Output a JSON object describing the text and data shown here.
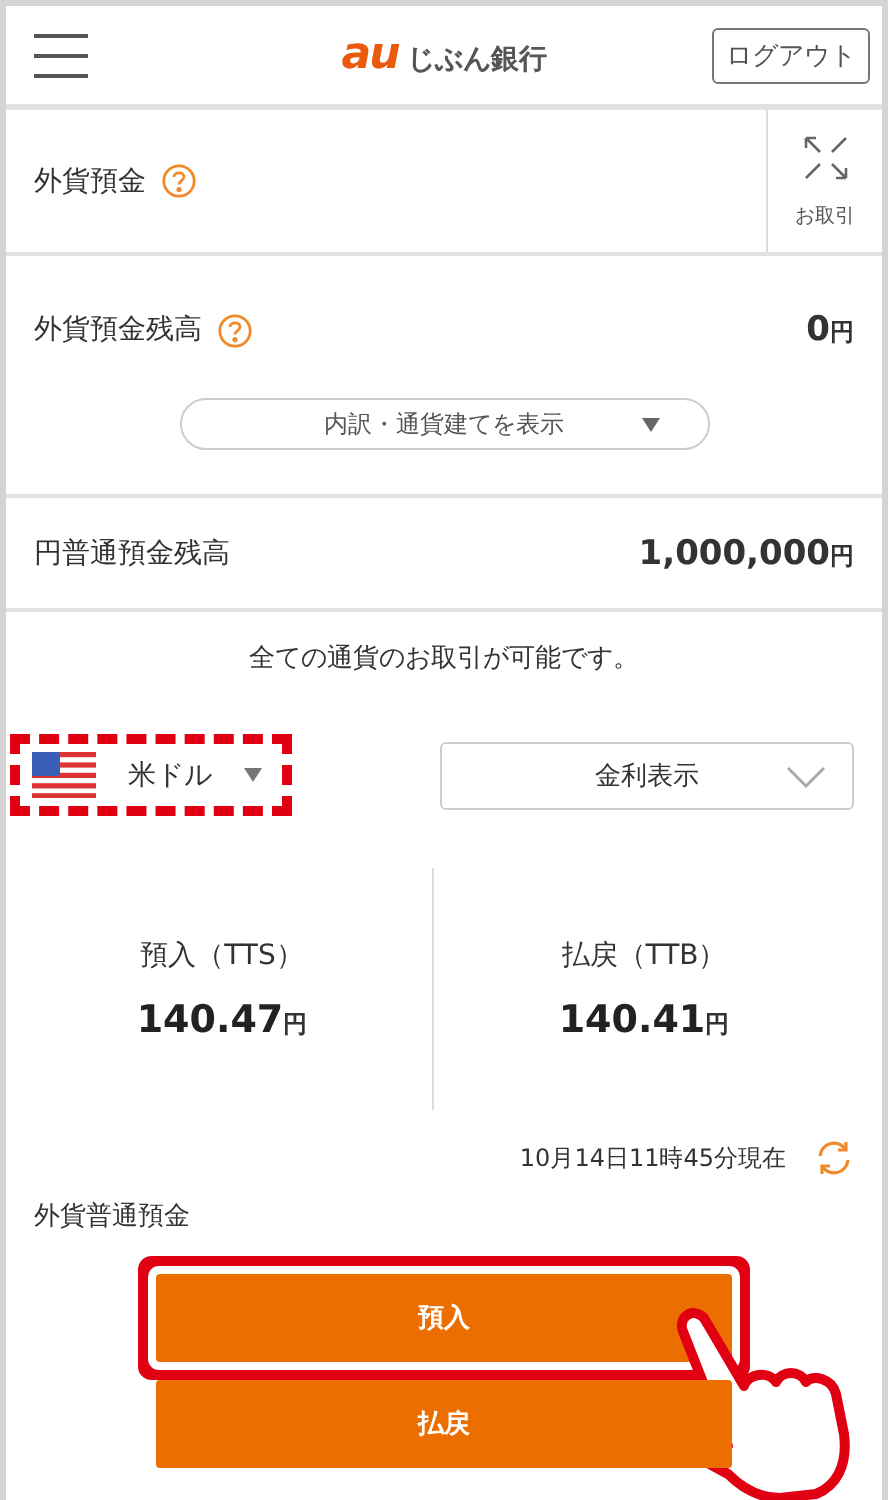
{
  "header": {
    "logo_mark": "au",
    "logo_text": "じぶん銀行",
    "logout": "ログアウト"
  },
  "fx_deposit": {
    "title": "外貨預金",
    "transactions": "お取引"
  },
  "fx_balance": {
    "label": "外貨預金残高",
    "amount": "0",
    "unit": "円",
    "breakdown": "内訳・通貨建てを表示"
  },
  "yen_balance": {
    "label": "円普通預金残高",
    "amount": "1,000,000",
    "unit": "円"
  },
  "notice": "全ての通貨のお取引が可能です。",
  "currency": {
    "name": "米ドル",
    "highlighted": true
  },
  "rate_view": "金利表示",
  "rates": [
    {
      "label": "預入（TTS）",
      "amount": "140.47",
      "unit": "円"
    },
    {
      "label": "払戻（TTB）",
      "amount": "140.41",
      "unit": "円"
    }
  ],
  "timestamp": "10月14日11時45分現在",
  "account": "外貨普通預金",
  "actions": [
    {
      "label": "預入",
      "highlighted": true,
      "pointer": true
    },
    {
      "label": "払戻",
      "highlighted": false
    }
  ]
}
